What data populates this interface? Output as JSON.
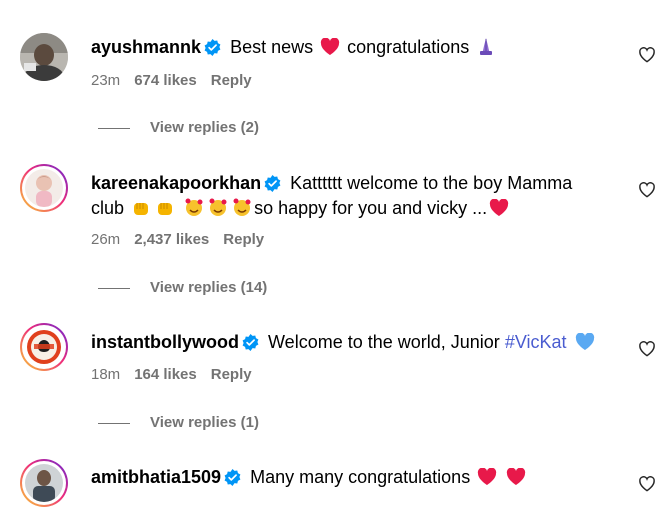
{
  "comments": [
    {
      "username": "ayushmannk",
      "text_parts": [
        "Best news",
        "congratulations"
      ],
      "time": "23m",
      "likes": "674 likes",
      "reply": "Reply",
      "view_replies": "View replies (2)"
    },
    {
      "username": "kareenakapoorkhan",
      "line1": "Katttttt welcome to the boy Mamma",
      "line2": "so happy for you and vicky ...",
      "time": "26m",
      "likes": "2,437 likes",
      "reply": "Reply",
      "view_replies": "View replies (14)"
    },
    {
      "username": "instantbollywood",
      "text": "Welcome to the world, Junior",
      "hashtag": "#VicKat",
      "time": "18m",
      "likes": "164 likes",
      "reply": "Reply",
      "view_replies": "View replies (1)"
    },
    {
      "username": "amitbhatia1509",
      "text": "Many many congratulations"
    }
  ],
  "colors": {
    "verified": "#0095f6",
    "meta": "#737373",
    "hashtag": "#4a5cd0",
    "heart_red": "#e8194a",
    "heart_blue": "#5aa9f2"
  },
  "icons": {
    "verified": "verified-badge-icon",
    "like": "heart-outline-icon"
  }
}
